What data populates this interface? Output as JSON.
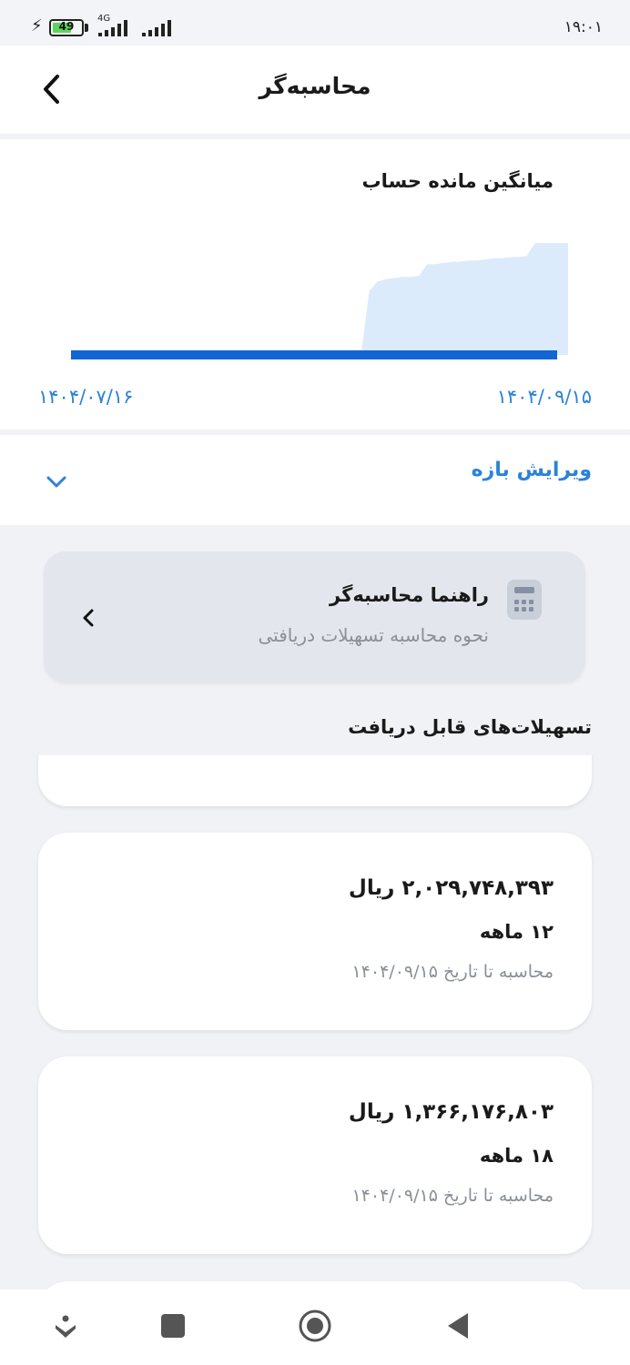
{
  "status_bar": {
    "time": "۱۹:۰۱",
    "battery_level": "49",
    "network": "4G",
    "icons": [
      "charging-icon",
      "battery-icon",
      "signal-icon",
      "signal-icon"
    ]
  },
  "header": {
    "title": "محاسبه‌گر",
    "back_icon": "chevron-left-icon"
  },
  "chart": {
    "title": "میانگین مانده حساب",
    "start_label": "۱۴۰۴/۰۷/۱۶",
    "end_label": "۱۴۰۴/۰۹/۱۵",
    "colors": {
      "area": "#dcebfb",
      "baseline": "#1266d4",
      "labels": "#2b83d8"
    }
  },
  "chart_data": {
    "type": "area",
    "title": "میانگین مانده حساب",
    "x_range": [
      "۱۴۰۴/۰۷/۱۶",
      "۱۴۰۴/۰۹/۱۵"
    ],
    "series": [
      {
        "values": [
          0,
          0,
          0,
          0,
          0,
          0,
          0,
          0,
          0,
          0,
          0,
          0,
          0,
          0,
          0,
          0,
          0,
          0,
          0,
          0,
          0,
          0,
          0,
          0,
          0,
          0,
          0,
          0,
          0,
          0,
          0,
          0,
          0,
          0,
          0,
          0,
          0.55,
          0.63,
          0.65,
          0.66,
          0.67,
          0.67,
          0.68,
          0.78,
          0.78,
          0.79,
          0.8,
          0.8,
          0.81,
          0.81,
          0.82,
          0.83,
          0.83,
          0.84,
          0.84,
          0.85,
          0.96,
          0.96,
          0.96,
          0.96,
          0.96
        ]
      }
    ],
    "ylim": [
      0,
      1
    ],
    "grid": false
  },
  "edit_range": {
    "label": "ویرایش بازه",
    "icon": "chevron-down-icon"
  },
  "guide": {
    "title": "راهنما محاسبه‌گر",
    "subtitle": "نحوه محاسبه تسهیلات دریافتی",
    "icon": "calculator-icon",
    "chevron": "chevron-left-icon"
  },
  "loans": {
    "section_title": "تسهیلات‌های قابل دریافت",
    "items": [
      {
        "amount": "",
        "term": "",
        "date": ""
      },
      {
        "amount": "۲,۰۲۹,۷۴۸,۳۹۳ ریال",
        "term": "۱۲ ماهه",
        "date": "محاسبه تا تاریخ ۱۴۰۴/۰۹/۱۵"
      },
      {
        "amount": "۱,۳۶۶,۱۷۶,۸۰۳ ریال",
        "term": "۱۸ ماهه",
        "date": "محاسبه تا تاریخ ۱۴۰۴/۰۹/۱۵"
      }
    ]
  },
  "nav_bar": {
    "icons": [
      "accessibility-icon",
      "recents-icon",
      "home-icon",
      "back-icon"
    ]
  }
}
